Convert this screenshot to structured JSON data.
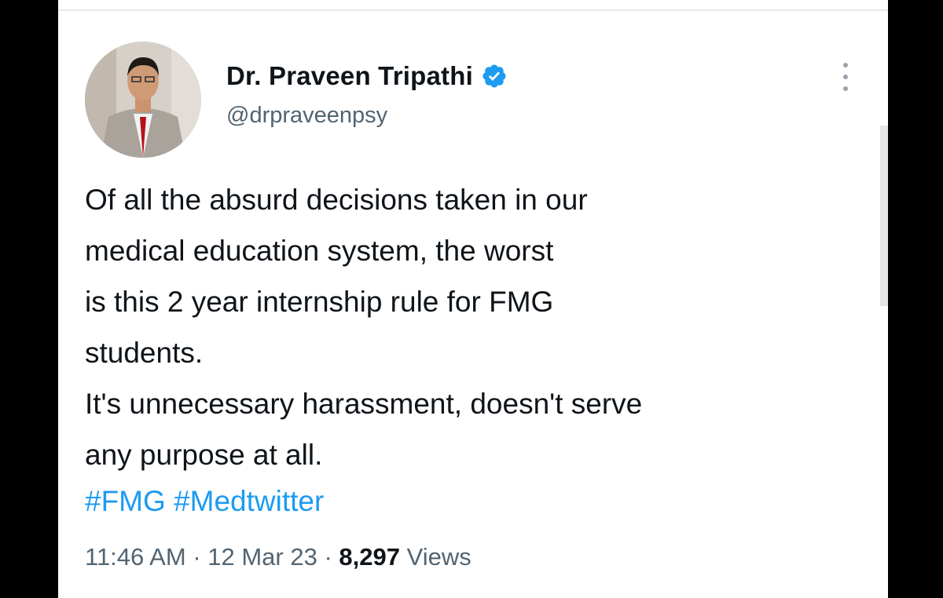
{
  "author": {
    "name": "Dr. Praveen Tripathi",
    "handle": "@drpraveenpsy",
    "verified_icon": "verified-badge-icon"
  },
  "tweet": {
    "lines": [
      "Of all the absurd decisions taken in our",
      "medical education system, the worst",
      "is this 2 year internship rule for FMG",
      "students.",
      "It's unnecessary harassment, doesn't serve",
      "any purpose at all."
    ],
    "hashtags": [
      "#FMG",
      "#Medtwitter"
    ]
  },
  "meta": {
    "time": "11:46 AM",
    "separator": "·",
    "date": "12 Mar 23",
    "views_count": "8,297",
    "views_label": "Views"
  },
  "colors": {
    "text": "#0f1419",
    "secondary": "#536471",
    "link": "#1d9bf0",
    "verified": "#1d9bf0"
  },
  "icons": {
    "more": "more-options-icon"
  }
}
